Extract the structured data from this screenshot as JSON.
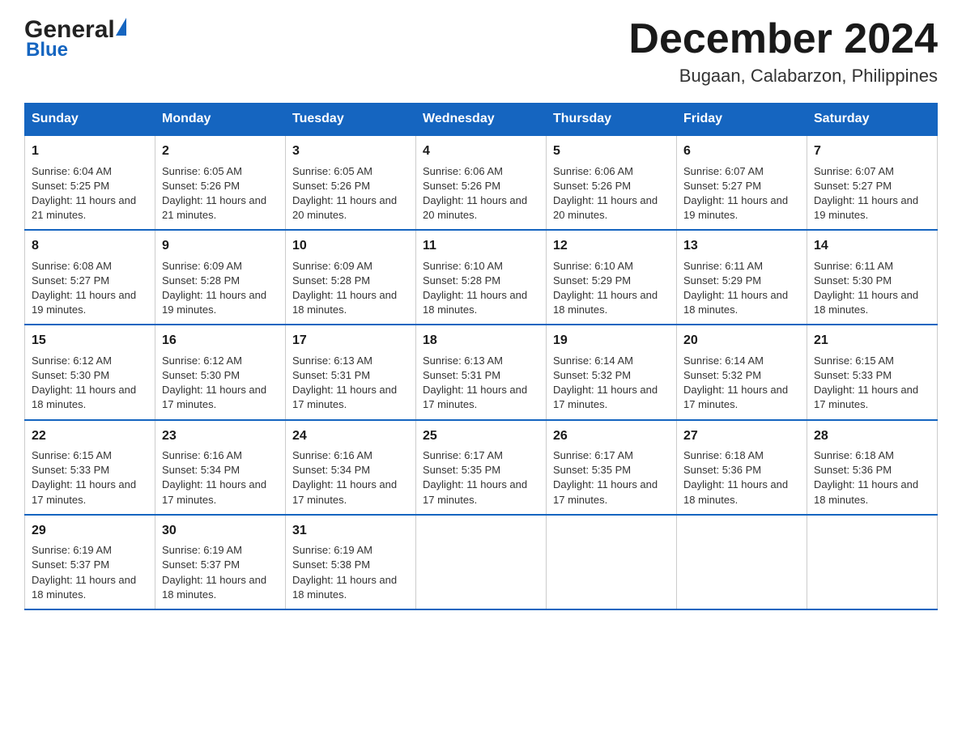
{
  "header": {
    "month_title": "December 2024",
    "location": "Bugaan, Calabarzon, Philippines",
    "logo_general": "General",
    "logo_blue": "Blue"
  },
  "weekdays": [
    "Sunday",
    "Monday",
    "Tuesday",
    "Wednesday",
    "Thursday",
    "Friday",
    "Saturday"
  ],
  "weeks": [
    [
      {
        "day": "1",
        "sunrise": "6:04 AM",
        "sunset": "5:25 PM",
        "daylight": "11 hours and 21 minutes."
      },
      {
        "day": "2",
        "sunrise": "6:05 AM",
        "sunset": "5:26 PM",
        "daylight": "11 hours and 21 minutes."
      },
      {
        "day": "3",
        "sunrise": "6:05 AM",
        "sunset": "5:26 PM",
        "daylight": "11 hours and 20 minutes."
      },
      {
        "day": "4",
        "sunrise": "6:06 AM",
        "sunset": "5:26 PM",
        "daylight": "11 hours and 20 minutes."
      },
      {
        "day": "5",
        "sunrise": "6:06 AM",
        "sunset": "5:26 PM",
        "daylight": "11 hours and 20 minutes."
      },
      {
        "day": "6",
        "sunrise": "6:07 AM",
        "sunset": "5:27 PM",
        "daylight": "11 hours and 19 minutes."
      },
      {
        "day": "7",
        "sunrise": "6:07 AM",
        "sunset": "5:27 PM",
        "daylight": "11 hours and 19 minutes."
      }
    ],
    [
      {
        "day": "8",
        "sunrise": "6:08 AM",
        "sunset": "5:27 PM",
        "daylight": "11 hours and 19 minutes."
      },
      {
        "day": "9",
        "sunrise": "6:09 AM",
        "sunset": "5:28 PM",
        "daylight": "11 hours and 19 minutes."
      },
      {
        "day": "10",
        "sunrise": "6:09 AM",
        "sunset": "5:28 PM",
        "daylight": "11 hours and 18 minutes."
      },
      {
        "day": "11",
        "sunrise": "6:10 AM",
        "sunset": "5:28 PM",
        "daylight": "11 hours and 18 minutes."
      },
      {
        "day": "12",
        "sunrise": "6:10 AM",
        "sunset": "5:29 PM",
        "daylight": "11 hours and 18 minutes."
      },
      {
        "day": "13",
        "sunrise": "6:11 AM",
        "sunset": "5:29 PM",
        "daylight": "11 hours and 18 minutes."
      },
      {
        "day": "14",
        "sunrise": "6:11 AM",
        "sunset": "5:30 PM",
        "daylight": "11 hours and 18 minutes."
      }
    ],
    [
      {
        "day": "15",
        "sunrise": "6:12 AM",
        "sunset": "5:30 PM",
        "daylight": "11 hours and 18 minutes."
      },
      {
        "day": "16",
        "sunrise": "6:12 AM",
        "sunset": "5:30 PM",
        "daylight": "11 hours and 17 minutes."
      },
      {
        "day": "17",
        "sunrise": "6:13 AM",
        "sunset": "5:31 PM",
        "daylight": "11 hours and 17 minutes."
      },
      {
        "day": "18",
        "sunrise": "6:13 AM",
        "sunset": "5:31 PM",
        "daylight": "11 hours and 17 minutes."
      },
      {
        "day": "19",
        "sunrise": "6:14 AM",
        "sunset": "5:32 PM",
        "daylight": "11 hours and 17 minutes."
      },
      {
        "day": "20",
        "sunrise": "6:14 AM",
        "sunset": "5:32 PM",
        "daylight": "11 hours and 17 minutes."
      },
      {
        "day": "21",
        "sunrise": "6:15 AM",
        "sunset": "5:33 PM",
        "daylight": "11 hours and 17 minutes."
      }
    ],
    [
      {
        "day": "22",
        "sunrise": "6:15 AM",
        "sunset": "5:33 PM",
        "daylight": "11 hours and 17 minutes."
      },
      {
        "day": "23",
        "sunrise": "6:16 AM",
        "sunset": "5:34 PM",
        "daylight": "11 hours and 17 minutes."
      },
      {
        "day": "24",
        "sunrise": "6:16 AM",
        "sunset": "5:34 PM",
        "daylight": "11 hours and 17 minutes."
      },
      {
        "day": "25",
        "sunrise": "6:17 AM",
        "sunset": "5:35 PM",
        "daylight": "11 hours and 17 minutes."
      },
      {
        "day": "26",
        "sunrise": "6:17 AM",
        "sunset": "5:35 PM",
        "daylight": "11 hours and 17 minutes."
      },
      {
        "day": "27",
        "sunrise": "6:18 AM",
        "sunset": "5:36 PM",
        "daylight": "11 hours and 18 minutes."
      },
      {
        "day": "28",
        "sunrise": "6:18 AM",
        "sunset": "5:36 PM",
        "daylight": "11 hours and 18 minutes."
      }
    ],
    [
      {
        "day": "29",
        "sunrise": "6:19 AM",
        "sunset": "5:37 PM",
        "daylight": "11 hours and 18 minutes."
      },
      {
        "day": "30",
        "sunrise": "6:19 AM",
        "sunset": "5:37 PM",
        "daylight": "11 hours and 18 minutes."
      },
      {
        "day": "31",
        "sunrise": "6:19 AM",
        "sunset": "5:38 PM",
        "daylight": "11 hours and 18 minutes."
      },
      null,
      null,
      null,
      null
    ]
  ]
}
